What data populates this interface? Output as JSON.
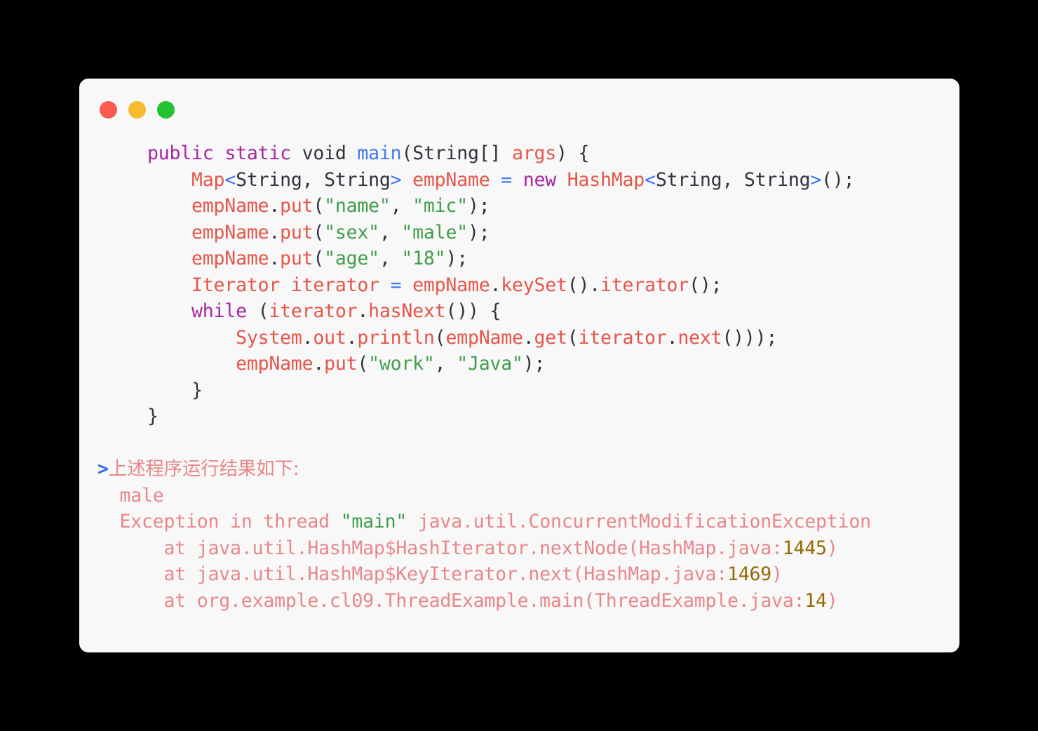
{
  "window": {
    "traffic_lights": [
      {
        "name": "close-button",
        "color": "#fb5a52"
      },
      {
        "name": "minimize-button",
        "color": "#f7bb2e"
      },
      {
        "name": "maximize-button",
        "color": "#23c231"
      }
    ],
    "background": "#f8f8f8",
    "page_background": "#000000"
  },
  "theme": {
    "keyword": "#a626a4",
    "function": "#4078f2",
    "variable": "#e45649",
    "string": "#3f9e4b",
    "number": "#986801",
    "plain": "#2f333d",
    "output": "#e8878a",
    "prompt": "#2f6fdb"
  },
  "code": {
    "language": "java",
    "lines": [
      {
        "indent": "    ",
        "tokens": [
          {
            "t": "public",
            "c": "kw"
          },
          {
            "t": " ",
            "c": "plain"
          },
          {
            "t": "static",
            "c": "kw"
          },
          {
            "t": " ",
            "c": "plain"
          },
          {
            "t": "void",
            "c": "plain"
          },
          {
            "t": " ",
            "c": "plain"
          },
          {
            "t": "main",
            "c": "fn"
          },
          {
            "t": "(",
            "c": "plain"
          },
          {
            "t": "String",
            "c": "plain"
          },
          {
            "t": "[] ",
            "c": "plain"
          },
          {
            "t": "args",
            "c": "var"
          },
          {
            "t": ") {",
            "c": "plain"
          }
        ]
      },
      {
        "indent": "        ",
        "tokens": [
          {
            "t": "Map",
            "c": "var"
          },
          {
            "t": "<",
            "c": "fn"
          },
          {
            "t": "String, String",
            "c": "plain"
          },
          {
            "t": ">",
            "c": "fn"
          },
          {
            "t": " ",
            "c": "plain"
          },
          {
            "t": "empName",
            "c": "var"
          },
          {
            "t": " ",
            "c": "plain"
          },
          {
            "t": "=",
            "c": "fn"
          },
          {
            "t": " ",
            "c": "plain"
          },
          {
            "t": "new",
            "c": "kw"
          },
          {
            "t": " ",
            "c": "plain"
          },
          {
            "t": "HashMap",
            "c": "var"
          },
          {
            "t": "<",
            "c": "fn"
          },
          {
            "t": "String, String",
            "c": "plain"
          },
          {
            "t": ">",
            "c": "fn"
          },
          {
            "t": "();",
            "c": "plain"
          }
        ]
      },
      {
        "indent": "        ",
        "tokens": [
          {
            "t": "empName",
            "c": "var"
          },
          {
            "t": ".",
            "c": "plain"
          },
          {
            "t": "put",
            "c": "var"
          },
          {
            "t": "(",
            "c": "plain"
          },
          {
            "t": "\"name\"",
            "c": "str"
          },
          {
            "t": ", ",
            "c": "plain"
          },
          {
            "t": "\"mic\"",
            "c": "str"
          },
          {
            "t": ");",
            "c": "plain"
          }
        ]
      },
      {
        "indent": "        ",
        "tokens": [
          {
            "t": "empName",
            "c": "var"
          },
          {
            "t": ".",
            "c": "plain"
          },
          {
            "t": "put",
            "c": "var"
          },
          {
            "t": "(",
            "c": "plain"
          },
          {
            "t": "\"sex\"",
            "c": "str"
          },
          {
            "t": ", ",
            "c": "plain"
          },
          {
            "t": "\"male\"",
            "c": "str"
          },
          {
            "t": ");",
            "c": "plain"
          }
        ]
      },
      {
        "indent": "        ",
        "tokens": [
          {
            "t": "empName",
            "c": "var"
          },
          {
            "t": ".",
            "c": "plain"
          },
          {
            "t": "put",
            "c": "var"
          },
          {
            "t": "(",
            "c": "plain"
          },
          {
            "t": "\"age\"",
            "c": "str"
          },
          {
            "t": ", ",
            "c": "plain"
          },
          {
            "t": "\"18\"",
            "c": "str"
          },
          {
            "t": ");",
            "c": "plain"
          }
        ]
      },
      {
        "indent": "        ",
        "tokens": [
          {
            "t": "Iterator iterator",
            "c": "var"
          },
          {
            "t": " ",
            "c": "plain"
          },
          {
            "t": "=",
            "c": "fn"
          },
          {
            "t": " ",
            "c": "plain"
          },
          {
            "t": "empName",
            "c": "var"
          },
          {
            "t": ".",
            "c": "plain"
          },
          {
            "t": "keySet",
            "c": "var"
          },
          {
            "t": "().",
            "c": "plain"
          },
          {
            "t": "iterator",
            "c": "var"
          },
          {
            "t": "();",
            "c": "plain"
          }
        ]
      },
      {
        "indent": "        ",
        "tokens": [
          {
            "t": "while",
            "c": "kw"
          },
          {
            "t": " (",
            "c": "plain"
          },
          {
            "t": "iterator",
            "c": "var"
          },
          {
            "t": ".",
            "c": "plain"
          },
          {
            "t": "hasNext",
            "c": "var"
          },
          {
            "t": "()) {",
            "c": "plain"
          }
        ]
      },
      {
        "indent": "            ",
        "tokens": [
          {
            "t": "System",
            "c": "var"
          },
          {
            "t": ".",
            "c": "plain"
          },
          {
            "t": "out",
            "c": "var"
          },
          {
            "t": ".",
            "c": "plain"
          },
          {
            "t": "println",
            "c": "var"
          },
          {
            "t": "(",
            "c": "plain"
          },
          {
            "t": "empName",
            "c": "var"
          },
          {
            "t": ".",
            "c": "plain"
          },
          {
            "t": "get",
            "c": "var"
          },
          {
            "t": "(",
            "c": "plain"
          },
          {
            "t": "iterator",
            "c": "var"
          },
          {
            "t": ".",
            "c": "plain"
          },
          {
            "t": "next",
            "c": "var"
          },
          {
            "t": "()));",
            "c": "plain"
          }
        ]
      },
      {
        "indent": "            ",
        "tokens": [
          {
            "t": "empName",
            "c": "var"
          },
          {
            "t": ".",
            "c": "plain"
          },
          {
            "t": "put",
            "c": "var"
          },
          {
            "t": "(",
            "c": "plain"
          },
          {
            "t": "\"work\"",
            "c": "str"
          },
          {
            "t": ", ",
            "c": "plain"
          },
          {
            "t": "\"Java\"",
            "c": "str"
          },
          {
            "t": ");",
            "c": "plain"
          }
        ]
      },
      {
        "indent": "        ",
        "tokens": [
          {
            "t": "}",
            "c": "plain"
          }
        ]
      },
      {
        "indent": "    ",
        "tokens": [
          {
            "t": "}",
            "c": "plain"
          }
        ]
      }
    ]
  },
  "terminal": {
    "prompt_symbol": ">",
    "prompt_text": "上述程序运行结果如下:",
    "lines": [
      {
        "indent": "  ",
        "tokens": [
          {
            "t": "male",
            "c": "out"
          }
        ]
      },
      {
        "indent": "  ",
        "tokens": [
          {
            "t": "Exception in thread ",
            "c": "out"
          },
          {
            "t": "\"main\"",
            "c": "outstr"
          },
          {
            "t": " java.util.ConcurrentModificationException",
            "c": "out"
          }
        ]
      },
      {
        "indent": "      ",
        "tokens": [
          {
            "t": "at java.util.HashMap$HashIterator.nextNode(HashMap.java:",
            "c": "out"
          },
          {
            "t": "1445",
            "c": "num"
          },
          {
            "t": ")",
            "c": "out"
          }
        ]
      },
      {
        "indent": "      ",
        "tokens": [
          {
            "t": "at java.util.HashMap$KeyIterator.next(HashMap.java:",
            "c": "out"
          },
          {
            "t": "1469",
            "c": "num"
          },
          {
            "t": ")",
            "c": "out"
          }
        ]
      },
      {
        "indent": "      ",
        "tokens": [
          {
            "t": "at org.example.cl09.ThreadExample.main(ThreadExample.java:",
            "c": "out"
          },
          {
            "t": "14",
            "c": "num"
          },
          {
            "t": ")",
            "c": "out"
          }
        ]
      }
    ]
  }
}
